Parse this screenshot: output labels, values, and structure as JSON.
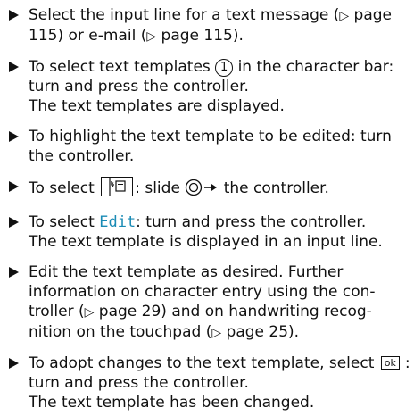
{
  "bullet_icon": "triangle-bullet-icon",
  "ref_glyph": "▷",
  "items": [
    {
      "parts": [
        "Select the input line for a text message (",
        " page 115) or e-mail (",
        " page 115)."
      ]
    },
    {
      "before": "To select text templates ",
      "circled_number": "1",
      "after": " in the character bar: turn and press the controller.",
      "result": "The text templates are displayed."
    },
    {
      "text": "To highlight the text template to be edited: turn the controller."
    },
    {
      "before": "To select ",
      "icon": "template-list-icon",
      "middle": ": slide ",
      "slide_icon": "controller-slide-right-icon",
      "after": " the controller."
    },
    {
      "before": "To select ",
      "edit_word": "Edit",
      "after": ": turn and press the controller.",
      "result": "The text template is displayed in an input line."
    },
    {
      "parts": [
        "Edit the text template as desired. Further information on character entry using the con-troller (",
        " page 29) and on handwriting recog-nition on the touchpad (",
        " page 25)."
      ]
    },
    {
      "before": "To adopt changes to the text template, select",
      "ok_label": "ok",
      "after": ": turn and press the controller.",
      "result": "The text template has been changed."
    }
  ]
}
